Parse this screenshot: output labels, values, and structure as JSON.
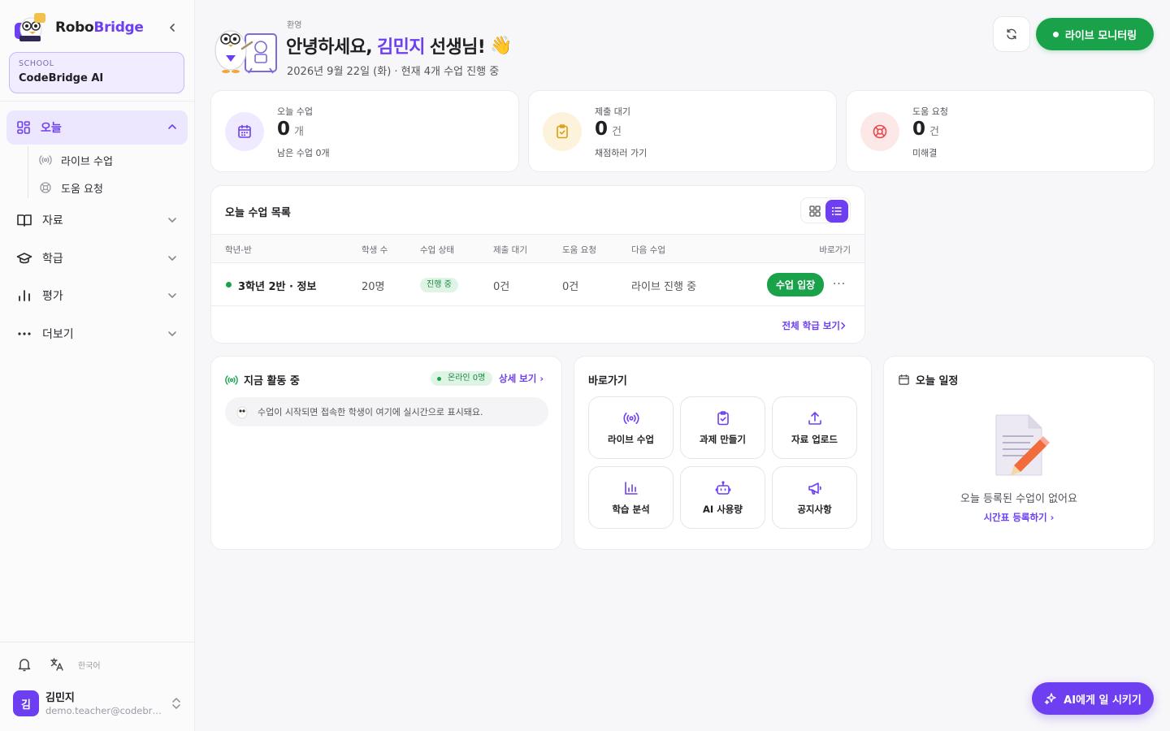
{
  "brand": {
    "name_part1": "Robo",
    "name_part2": "Bridge"
  },
  "school": {
    "label": "SCHOOL",
    "name": "CodeBridge AI"
  },
  "sidebar": {
    "today": "오늘",
    "sub_items": [
      {
        "label": "라이브 수업",
        "icon": "broadcast-icon"
      },
      {
        "label": "도움 요청",
        "icon": "lifebuoy-icon"
      }
    ],
    "items": [
      {
        "label": "자료",
        "icon": "book-icon"
      },
      {
        "label": "학급",
        "icon": "graduation-cap-icon"
      },
      {
        "label": "평가",
        "icon": "bar-chart-icon"
      },
      {
        "label": "더보기",
        "icon": "more-dots-icon"
      }
    ],
    "language": "한국어"
  },
  "user": {
    "initial": "김",
    "name": "김민지",
    "email": "demo.teacher@codebridge.ai"
  },
  "header": {
    "eyebrow": "환영",
    "greeting": "안녕하세요,",
    "name": "김민지",
    "suffix": "선생님!",
    "wave": "👋",
    "subtitle": "2026년 9월 22일 (화) · 현재 4개 수업 진행 중",
    "live_button": "라이브 모니터링"
  },
  "stats": [
    {
      "label": "오늘 수업",
      "value": "0",
      "unit": "개",
      "sub": "남은 수업 0개",
      "icon": "calendar-icon",
      "color": "#6d3ff0",
      "bg": "#efeaff"
    },
    {
      "label": "제출 대기",
      "value": "0",
      "unit": "건",
      "sub": "채점하러 가기",
      "icon": "clipboard-check-icon",
      "color": "#d9a012",
      "bg": "#fdf3dc"
    },
    {
      "label": "도움 요청",
      "value": "0",
      "unit": "건",
      "sub": "미해결",
      "icon": "lifebuoy-icon",
      "color": "#e5484d",
      "bg": "#fde8e8"
    }
  ],
  "classes": {
    "title": "오늘 수업 목록",
    "headers": [
      "학년-반",
      "학생 수",
      "수업 상태",
      "제출 대기",
      "도움 요청",
      "다음 수업",
      "바로가기"
    ],
    "row": {
      "name": "3학년 2반 · 정보",
      "students": "20명",
      "status": "진행 중",
      "pending": "0건",
      "help": "0건",
      "next": "라이브 진행 중",
      "enter": "수업 입장",
      "more": "···"
    },
    "view_all": "전체 학급 보기"
  },
  "activity": {
    "title": "지금 활동 중",
    "online": "온라인 0명",
    "detail": "상세 보기",
    "note": "수업이 시작되면 접속한 학생이 여기에 실시간으로 표시돼요."
  },
  "quick": {
    "title": "바로가기",
    "actions": [
      {
        "label": "라이브 수업",
        "icon": "broadcast-icon"
      },
      {
        "label": "과제 만들기",
        "icon": "clipboard-check-icon"
      },
      {
        "label": "자료 업로드",
        "icon": "upload-icon"
      },
      {
        "label": "학습 분석",
        "icon": "bar-chart-icon"
      },
      {
        "label": "AI 사용량",
        "icon": "robot-icon"
      },
      {
        "label": "공지사항",
        "icon": "megaphone-icon"
      }
    ]
  },
  "schedule": {
    "title": "오늘 일정",
    "empty": "오늘 등록된 수업이 없어요",
    "link": "시간표 등록하기"
  },
  "ai_button": "AI에게 일 시키기",
  "colors": {
    "accent": "#6d3ff0",
    "success": "#1aa24b"
  }
}
